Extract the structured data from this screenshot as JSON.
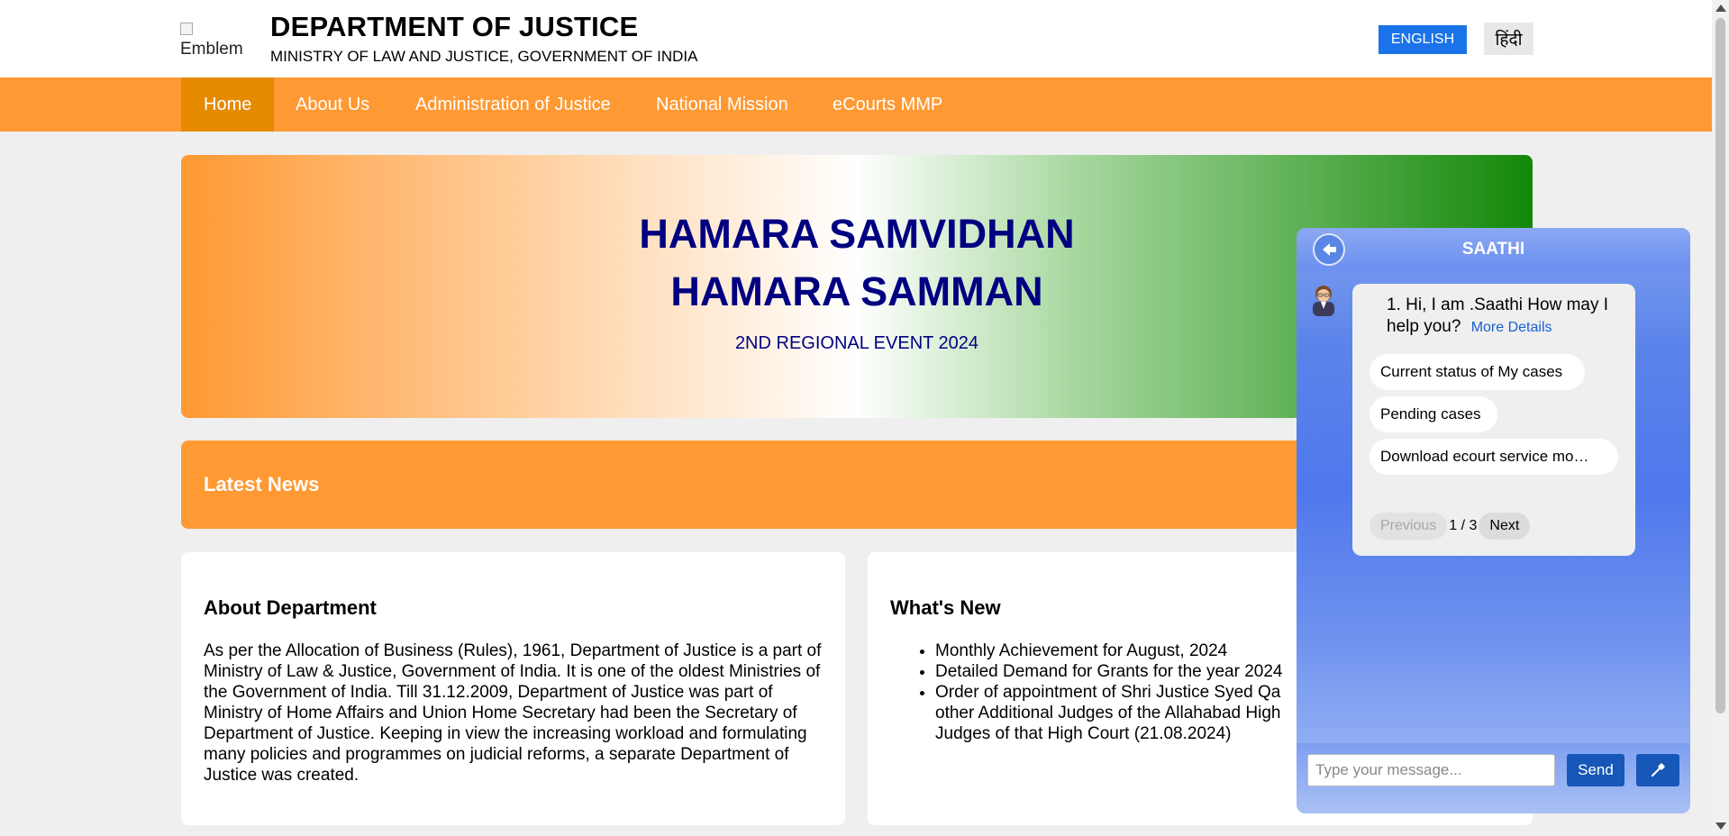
{
  "header": {
    "emblem_alt": "Emblem",
    "title": "DEPARTMENT OF JUSTICE",
    "subtitle": "MINISTRY OF LAW AND JUSTICE, GOVERNMENT OF INDIA",
    "lang_english": "ENGLISH",
    "lang_hindi": "हिंदी"
  },
  "nav": {
    "items": [
      {
        "label": "Home",
        "active": true
      },
      {
        "label": "About Us"
      },
      {
        "label": "Administration of Justice"
      },
      {
        "label": "National Mission"
      },
      {
        "label": "eCourts MMP"
      }
    ]
  },
  "banner": {
    "line1": "HAMARA SAMVIDHAN",
    "line2": "HAMARA SAMMAN",
    "subtitle": "2ND REGIONAL EVENT 2024"
  },
  "news": {
    "title": "Latest News"
  },
  "about": {
    "title": "About Department",
    "text": "As per the Allocation of Business (Rules), 1961, Department of Justice is a part of Ministry of Law & Justice, Government of India. It is one of the oldest Ministries of the Government of India. Till 31.12.2009, Department of Justice was part of Ministry of Home Affairs and Union Home Secretary had been the Secretary of Department of Justice. Keeping in view the increasing workload and formulating many policies and programmes on judicial reforms, a separate Department of Justice was created."
  },
  "whats_new": {
    "title": "What's New",
    "items": [
      "Monthly Achievement for August, 2024",
      "Detailed Demand for Grants for the year 2024",
      "Order of appointment of Shri Justice Syed Qa",
      "other Additional Judges of the Allahabad High",
      "Judges of that High Court (21.08.2024)"
    ]
  },
  "chat": {
    "title": "SAATHI",
    "greeting": "1. Hi, I am .Saathi How may I help you?",
    "more_details": "More Details",
    "options": [
      "Current status of My cases",
      "Pending cases",
      "Download ecourt service mo…"
    ],
    "prev_label": "Previous",
    "page_indicator": "1 / 3",
    "next_label": "Next",
    "input_placeholder": "Type your message...",
    "send_label": "Send"
  },
  "colors": {
    "saffron": "#ff9933",
    "nav_active": "#e68a00",
    "banner_text": "#000080",
    "green": "#138808",
    "english_button": "#1a73e8",
    "chat_send": "#1657b8"
  },
  "icons": {
    "chat_back": "back-arrow-icon",
    "chat_avatar": "bot-avatar-icon",
    "chat_mic": "mic-icon"
  }
}
